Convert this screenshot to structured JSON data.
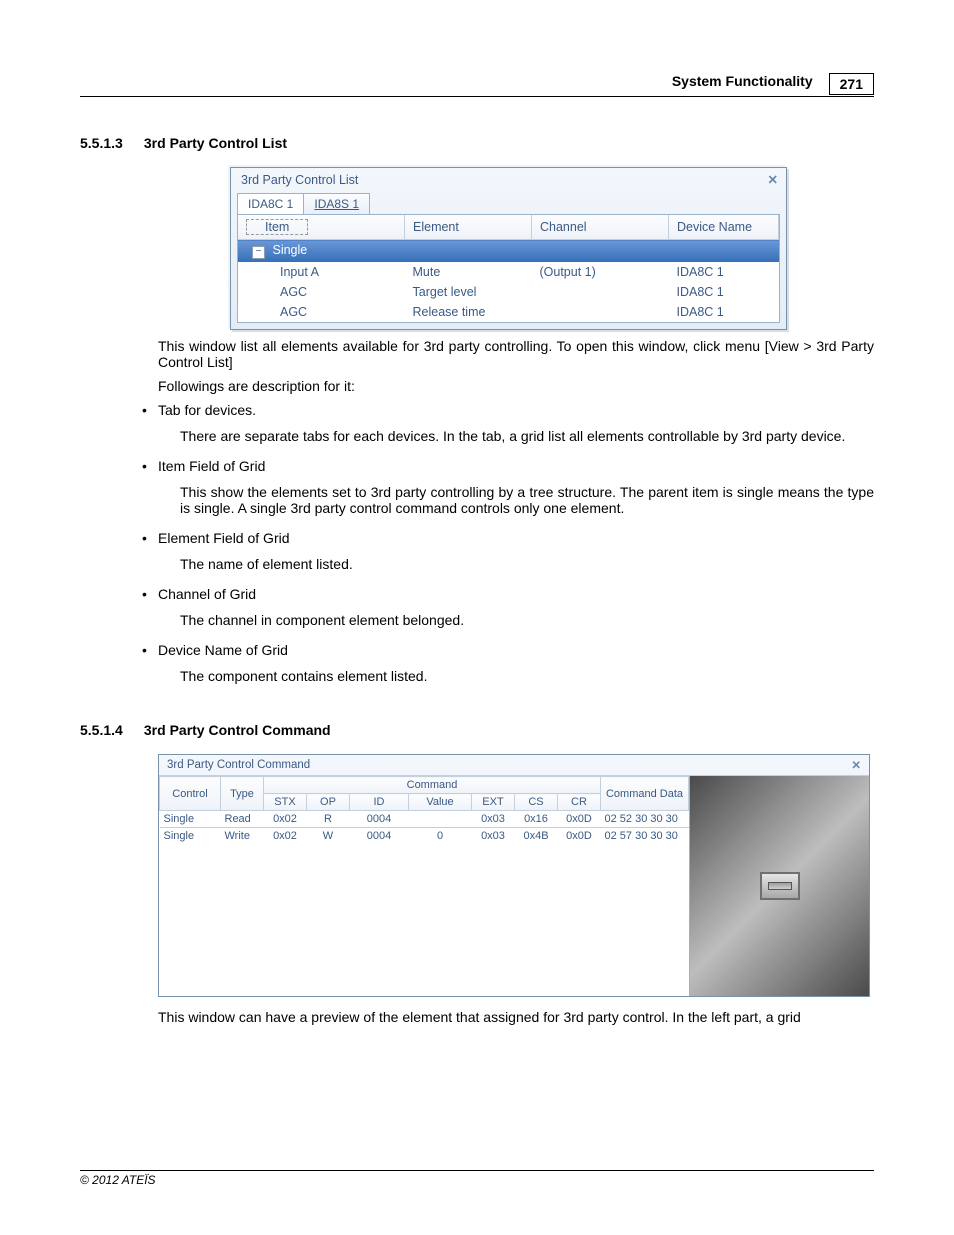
{
  "header": {
    "title": "System Functionality",
    "page_number": "271"
  },
  "section1": {
    "num": "5.5.1.3",
    "title": "3rd Party Control List",
    "window": {
      "caption": "3rd Party Control List",
      "tabs": [
        {
          "label": "IDA8C 1",
          "active": true
        },
        {
          "label": "IDA8S 1",
          "active": false
        }
      ],
      "columns": [
        "Item",
        "Element",
        "Channel",
        "Device Name"
      ],
      "rows": [
        {
          "type": "group",
          "item": "Single",
          "selected": true
        },
        {
          "type": "data",
          "item": "Input A",
          "element": "Mute",
          "channel": "(Output 1)",
          "device": "IDA8C 1"
        },
        {
          "type": "data",
          "item": "AGC",
          "element": "Target level",
          "channel": "",
          "device": "IDA8C 1"
        },
        {
          "type": "data",
          "item": "AGC",
          "element": "Release time",
          "channel": "",
          "device": "IDA8C 1"
        }
      ]
    },
    "intro": "This window list all elements available for 3rd party controlling. To open this window, click menu [View > 3rd Party Control List]",
    "followings_label": "Followings are description for it:",
    "bullets": [
      {
        "title": "Tab for devices.",
        "desc": "There are separate tabs for each devices. In the tab, a grid list all elements controllable by 3rd party device."
      },
      {
        "title": "Item Field of Grid",
        "desc": "This show the elements set to 3rd party controlling by a tree structure. The parent item is single means the type is single. A single 3rd party control command controls only one element."
      },
      {
        "title": "Element Field of Grid",
        "desc": "The name of element listed."
      },
      {
        "title": "Channel of Grid",
        "desc": "The channel in component element belonged."
      },
      {
        "title": "Device Name of Grid",
        "desc": "The component contains element listed."
      }
    ]
  },
  "section2": {
    "num": "5.5.1.4",
    "title": "3rd Party Control Command",
    "window": {
      "caption": "3rd Party Control Command",
      "group_header": "Command",
      "columns_top": [
        "Control",
        "Type"
      ],
      "columns_cmd": [
        "STX",
        "OP",
        "ID",
        "Value",
        "EXT",
        "CS",
        "CR"
      ],
      "column_cmddata": "Command Data",
      "rows": [
        {
          "control": "Single",
          "type": "Read",
          "stx": "0x02",
          "op": "R",
          "id": "0004",
          "value": "",
          "ext": "0x03",
          "cs": "0x16",
          "cr": "0x0D",
          "cmddata": "02 52 30 30 30"
        },
        {
          "control": "Single",
          "type": "Write",
          "stx": "0x02",
          "op": "W",
          "id": "0004",
          "value": "0",
          "ext": "0x03",
          "cs": "0x4B",
          "cr": "0x0D",
          "cmddata": "02 57 30 30 30"
        }
      ]
    },
    "outro": "This window can have a preview of the element that assigned for 3rd party control. In the left part, a grid"
  },
  "footer": {
    "copyright": "© 2012 ATEÏS"
  }
}
